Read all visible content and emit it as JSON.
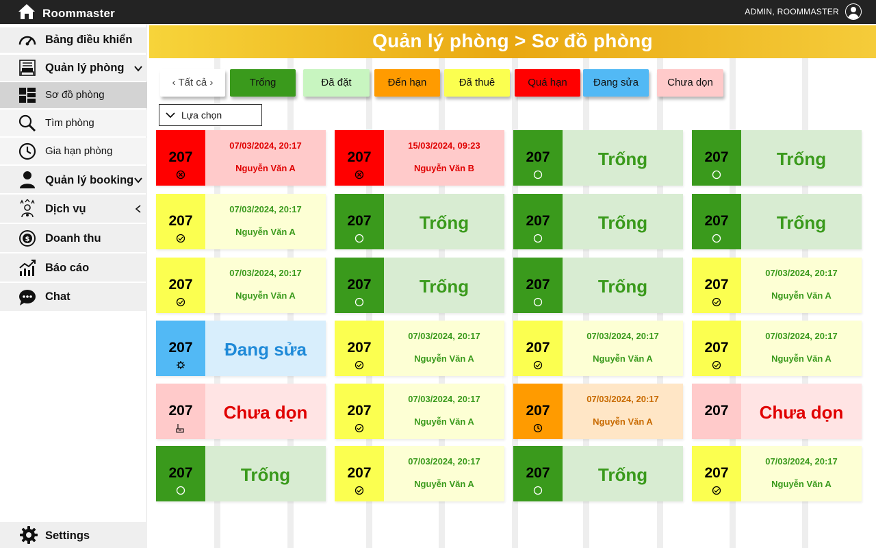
{
  "app": {
    "name": "Roommaster",
    "user": "ADMIN, ROOMMASTER"
  },
  "sidebar": {
    "items": [
      {
        "label": "Bảng điều khiển",
        "icon": "dashboard-icon"
      },
      {
        "label": "Quản lý phòng",
        "icon": "hotel-icon"
      },
      {
        "label": "Sơ đồ phòng",
        "icon": "grid-icon"
      },
      {
        "label": "Tìm phòng",
        "icon": "search-icon"
      },
      {
        "label": "Gia hạn phòng",
        "icon": "clock-icon"
      },
      {
        "label": "Quản lý booking",
        "icon": "user-icon"
      },
      {
        "label": "Dịch vụ",
        "icon": "service-icon"
      },
      {
        "label": "Doanh thu",
        "icon": "revenue-icon"
      },
      {
        "label": "Báo cáo",
        "icon": "report-icon"
      },
      {
        "label": "Chat",
        "icon": "chat-icon"
      }
    ],
    "settings": "Settings"
  },
  "header": {
    "title": "Quản lý phòng > Sơ đồ phòng"
  },
  "filters": [
    {
      "label": "‹ Tất cả ›",
      "color": "#ffffff",
      "text_color": "#333333"
    },
    {
      "label": "Trống",
      "color": "#3a9a1c",
      "text_color": "#ffffff"
    },
    {
      "label": "Đã đặt",
      "color": "#c8f5c0",
      "text_color": "#222222"
    },
    {
      "label": "Đến hạn",
      "color": "#ff9b00",
      "text_color": "#222222"
    },
    {
      "label": "Đã thuê",
      "color": "#fbff50",
      "text_color": "#222222"
    },
    {
      "label": "Quá hạn",
      "color": "#ff0000",
      "text_color": "#222222"
    },
    {
      "label": "Đang sửa",
      "color": "#52b9f5",
      "text_color": "#222222"
    },
    {
      "label": "Chưa dọn",
      "color": "#ffcaca",
      "text_color": "#222222"
    }
  ],
  "dropdown": {
    "label": "Lựa chọn"
  },
  "status_styles": {
    "overdue": {
      "num_bg": "#ff0000",
      "body_bg": "#ffcaca",
      "text": "#e00000",
      "icon": "x-circle-icon"
    },
    "empty": {
      "num_bg": "#3a9a1c",
      "body_bg": "#d8ecd2",
      "text": "#3a9a1c",
      "icon": "circle-icon"
    },
    "rented": {
      "num_bg": "#fbff50",
      "body_bg": "#fdffd4",
      "text": "#3a9a1c",
      "icon": "check-circle-icon"
    },
    "repair": {
      "num_bg": "#52b9f5",
      "body_bg": "#d8eefc",
      "text": "#1f8ad8",
      "icon": "gear-icon"
    },
    "dirty": {
      "num_bg": "#ffcaca",
      "body_bg": "#ffe4e4",
      "text": "#e00000",
      "icon": "broom-icon"
    },
    "due": {
      "num_bg": "#ff9b00",
      "body_bg": "#ffe6c6",
      "text": "#c86a00",
      "icon": "clock-icon"
    }
  },
  "rooms": [
    {
      "room": "207",
      "status": "overdue",
      "date": "07/03/2024, 20:17",
      "guest": "Nguyễn Văn A"
    },
    {
      "room": "207",
      "status": "overdue",
      "date": "15/03/2024, 09:23",
      "guest": "Nguyễn Văn B"
    },
    {
      "room": "207",
      "status": "empty",
      "label": "Trống"
    },
    {
      "room": "207",
      "status": "empty",
      "label": "Trống"
    },
    {
      "room": "207",
      "status": "rented",
      "date": "07/03/2024, 20:17",
      "guest": "Nguyễn Văn A"
    },
    {
      "room": "207",
      "status": "empty",
      "label": "Trống"
    },
    {
      "room": "207",
      "status": "empty",
      "label": "Trống"
    },
    {
      "room": "207",
      "status": "empty",
      "label": "Trống"
    },
    {
      "room": "207",
      "status": "rented",
      "date": "07/03/2024, 20:17",
      "guest": "Nguyễn Văn A"
    },
    {
      "room": "207",
      "status": "empty",
      "label": "Trống"
    },
    {
      "room": "207",
      "status": "empty",
      "label": "Trống"
    },
    {
      "room": "207",
      "status": "rented",
      "date": "07/03/2024, 20:17",
      "guest": "Nguyễn Văn A"
    },
    {
      "room": "207",
      "status": "repair",
      "label": "Đang sửa"
    },
    {
      "room": "207",
      "status": "rented",
      "date": "07/03/2024, 20:17",
      "guest": "Nguyễn Văn A"
    },
    {
      "room": "207",
      "status": "rented",
      "date": "07/03/2024, 20:17",
      "guest": "Nguyễn Văn A"
    },
    {
      "room": "207",
      "status": "rented",
      "date": "07/03/2024, 20:17",
      "guest": "Nguyễn Văn A"
    },
    {
      "room": "207",
      "status": "dirty",
      "label": "Chưa dọn"
    },
    {
      "room": "207",
      "status": "rented",
      "date": "07/03/2024, 20:17",
      "guest": "Nguyễn Văn A"
    },
    {
      "room": "207",
      "status": "due",
      "date": "07/03/2024, 20:17",
      "guest": "Nguyễn Văn A"
    },
    {
      "room": "207",
      "status": "dirty",
      "label": "Chưa dọn"
    },
    {
      "room": "207",
      "status": "empty",
      "label": "Trống"
    },
    {
      "room": "207",
      "status": "rented",
      "date": "07/03/2024, 20:17",
      "guest": "Nguyễn Văn A"
    },
    {
      "room": "207",
      "status": "empty",
      "label": "Trống"
    },
    {
      "room": "207",
      "status": "rented",
      "date": "07/03/2024, 20:17",
      "guest": "Nguyễn Văn A"
    }
  ]
}
